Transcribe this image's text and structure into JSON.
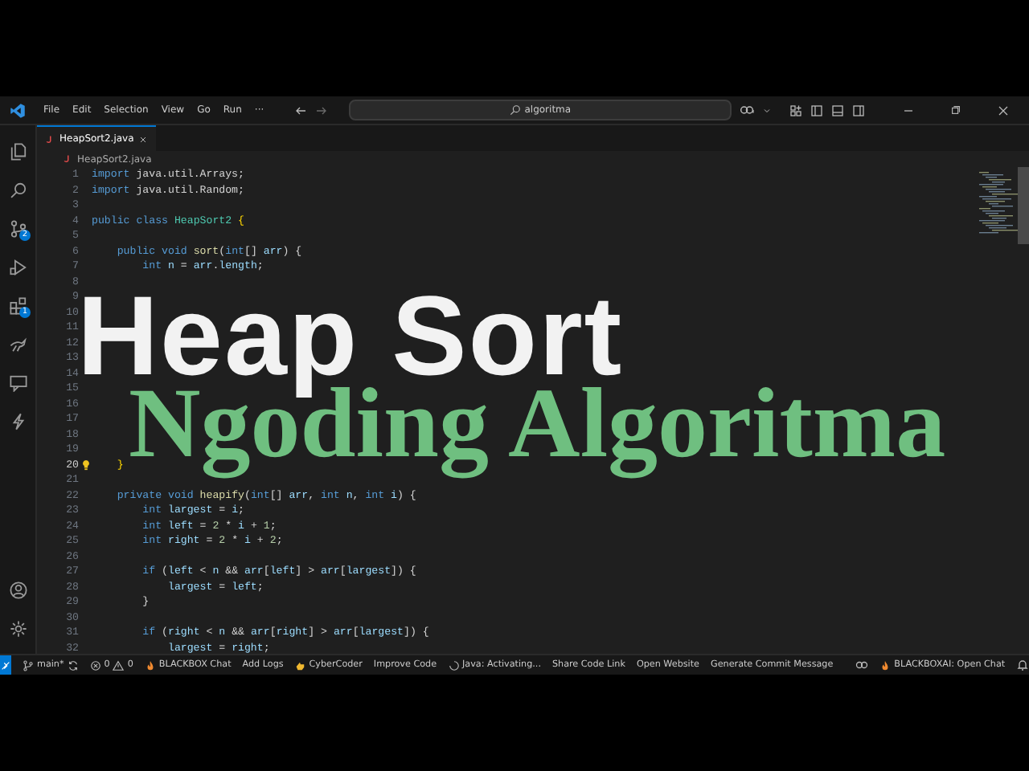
{
  "title_bar": {
    "menu": [
      "File",
      "Edit",
      "Selection",
      "View",
      "Go",
      "Run",
      "···"
    ],
    "search": {
      "value": "algoritma"
    }
  },
  "activity_bar": {
    "items": [
      {
        "kind": "files"
      },
      {
        "kind": "search"
      },
      {
        "kind": "source-control",
        "badge": "2"
      },
      {
        "kind": "run"
      },
      {
        "kind": "extensions",
        "badge": "1"
      },
      {
        "kind": "kangaroo"
      },
      {
        "kind": "chat"
      },
      {
        "kind": "bolt"
      }
    ],
    "bottom": [
      {
        "kind": "account"
      },
      {
        "kind": "settings"
      }
    ]
  },
  "tabs": [
    {
      "label": "HeapSort2.java",
      "selected": true
    }
  ],
  "breadcrumb": "HeapSort2.java",
  "code": {
    "lines": [
      {
        "n": "1",
        "active": false,
        "segments": [
          {
            "kind": "keyword",
            "text": "import"
          },
          {
            "kind": "plain",
            "text": " java.util.Arrays;"
          }
        ]
      },
      {
        "n": "2",
        "active": false,
        "segments": [
          {
            "kind": "keyword",
            "text": "import"
          },
          {
            "kind": "plain",
            "text": " java.util.Random;"
          }
        ]
      },
      {
        "n": "3",
        "active": false
      },
      {
        "n": "4",
        "active": false,
        "segments": [
          {
            "kind": "keyword",
            "text": "public class "
          },
          {
            "kind": "type",
            "text": "HeapSort2"
          },
          {
            "kind": "bracket",
            "text": " {"
          }
        ]
      },
      {
        "n": "5",
        "active": false
      },
      {
        "n": "6",
        "active": false,
        "segments": [
          {
            "kind": "keyword",
            "text": "    public void "
          },
          {
            "kind": "function",
            "text": "sort"
          },
          {
            "kind": "plain",
            "text": "("
          },
          {
            "kind": "keyword",
            "text": "int"
          },
          {
            "kind": "plain",
            "text": "[] "
          },
          {
            "kind": "variable",
            "text": "arr"
          },
          {
            "kind": "plain",
            "text": ") {"
          }
        ]
      },
      {
        "n": "7",
        "active": false,
        "segments": [
          {
            "kind": "keyword",
            "text": "        int "
          },
          {
            "kind": "variable",
            "text": "n"
          },
          {
            "kind": "plain",
            "text": " = "
          },
          {
            "kind": "variable",
            "text": "arr"
          },
          {
            "kind": "plain",
            "text": "."
          },
          {
            "kind": "variable",
            "text": "length"
          },
          {
            "kind": "plain",
            "text": ";"
          }
        ]
      },
      {
        "n": "8",
        "active": false
      },
      {
        "n": "9",
        "active": false
      },
      {
        "n": "10",
        "active": false
      },
      {
        "n": "11",
        "active": false
      },
      {
        "n": "12",
        "active": false
      },
      {
        "n": "13",
        "active": false
      },
      {
        "n": "14",
        "active": false
      },
      {
        "n": "15",
        "active": false
      },
      {
        "n": "16",
        "active": false
      },
      {
        "n": "17",
        "active": false
      },
      {
        "n": "18",
        "active": false
      },
      {
        "n": "19",
        "active": false
      },
      {
        "n": "20",
        "active": true,
        "lightbulb": true,
        "segments": [
          {
            "kind": "bracket",
            "text": "    }"
          }
        ]
      },
      {
        "n": "21",
        "active": false
      },
      {
        "n": "22",
        "active": false,
        "segments": [
          {
            "kind": "keyword",
            "text": "    private void "
          },
          {
            "kind": "function",
            "text": "heapify"
          },
          {
            "kind": "plain",
            "text": "("
          },
          {
            "kind": "keyword",
            "text": "int"
          },
          {
            "kind": "plain",
            "text": "[] "
          },
          {
            "kind": "variable",
            "text": "arr"
          },
          {
            "kind": "plain",
            "text": ", "
          },
          {
            "kind": "keyword",
            "text": "int "
          },
          {
            "kind": "variable",
            "text": "n"
          },
          {
            "kind": "plain",
            "text": ", "
          },
          {
            "kind": "keyword",
            "text": "int "
          },
          {
            "kind": "variable",
            "text": "i"
          },
          {
            "kind": "plain",
            "text": ") {"
          }
        ]
      },
      {
        "n": "23",
        "active": false,
        "segments": [
          {
            "kind": "keyword",
            "text": "        int "
          },
          {
            "kind": "variable",
            "text": "largest"
          },
          {
            "kind": "plain",
            "text": " = "
          },
          {
            "kind": "variable",
            "text": "i"
          },
          {
            "kind": "plain",
            "text": ";"
          }
        ]
      },
      {
        "n": "24",
        "active": false,
        "segments": [
          {
            "kind": "keyword",
            "text": "        int "
          },
          {
            "kind": "variable",
            "text": "left"
          },
          {
            "kind": "plain",
            "text": " = "
          },
          {
            "kind": "number",
            "text": "2"
          },
          {
            "kind": "plain",
            "text": " * "
          },
          {
            "kind": "variable",
            "text": "i"
          },
          {
            "kind": "plain",
            "text": " + "
          },
          {
            "kind": "number",
            "text": "1"
          },
          {
            "kind": "plain",
            "text": ";"
          }
        ]
      },
      {
        "n": "25",
        "active": false,
        "segments": [
          {
            "kind": "keyword",
            "text": "        int "
          },
          {
            "kind": "variable",
            "text": "right"
          },
          {
            "kind": "plain",
            "text": " = "
          },
          {
            "kind": "number",
            "text": "2"
          },
          {
            "kind": "plain",
            "text": " * "
          },
          {
            "kind": "variable",
            "text": "i"
          },
          {
            "kind": "plain",
            "text": " + "
          },
          {
            "kind": "number",
            "text": "2"
          },
          {
            "kind": "plain",
            "text": ";"
          }
        ]
      },
      {
        "n": "26",
        "active": false
      },
      {
        "n": "27",
        "active": false,
        "segments": [
          {
            "kind": "keyword",
            "text": "        if"
          },
          {
            "kind": "plain",
            "text": " ("
          },
          {
            "kind": "variable",
            "text": "left"
          },
          {
            "kind": "plain",
            "text": " < "
          },
          {
            "kind": "variable",
            "text": "n"
          },
          {
            "kind": "plain",
            "text": " && "
          },
          {
            "kind": "variable",
            "text": "arr"
          },
          {
            "kind": "plain",
            "text": "["
          },
          {
            "kind": "variable",
            "text": "left"
          },
          {
            "kind": "plain",
            "text": "] > "
          },
          {
            "kind": "variable",
            "text": "arr"
          },
          {
            "kind": "plain",
            "text": "["
          },
          {
            "kind": "variable",
            "text": "largest"
          },
          {
            "kind": "plain",
            "text": "]) {"
          }
        ]
      },
      {
        "n": "28",
        "active": false,
        "segments": [
          {
            "kind": "variable",
            "text": "            largest"
          },
          {
            "kind": "plain",
            "text": " = "
          },
          {
            "kind": "variable",
            "text": "left"
          },
          {
            "kind": "plain",
            "text": ";"
          }
        ]
      },
      {
        "n": "29",
        "active": false,
        "segments": [
          {
            "kind": "plain",
            "text": "        }"
          }
        ]
      },
      {
        "n": "30",
        "active": false
      },
      {
        "n": "31",
        "active": false,
        "segments": [
          {
            "kind": "keyword",
            "text": "        if"
          },
          {
            "kind": "plain",
            "text": " ("
          },
          {
            "kind": "variable",
            "text": "right"
          },
          {
            "kind": "plain",
            "text": " < "
          },
          {
            "kind": "variable",
            "text": "n"
          },
          {
            "kind": "plain",
            "text": " && "
          },
          {
            "kind": "variable",
            "text": "arr"
          },
          {
            "kind": "plain",
            "text": "["
          },
          {
            "kind": "variable",
            "text": "right"
          },
          {
            "kind": "plain",
            "text": "] > "
          },
          {
            "kind": "variable",
            "text": "arr"
          },
          {
            "kind": "plain",
            "text": "["
          },
          {
            "kind": "variable",
            "text": "largest"
          },
          {
            "kind": "plain",
            "text": "]) {"
          }
        ]
      },
      {
        "n": "32",
        "active": false,
        "segments": [
          {
            "kind": "variable",
            "text": "            largest"
          },
          {
            "kind": "plain",
            "text": " = "
          },
          {
            "kind": "variable",
            "text": "right"
          },
          {
            "kind": "plain",
            "text": ";"
          }
        ]
      }
    ]
  },
  "headline": {
    "title": "Heap Sort",
    "subtitle": "Ngoding Algoritma"
  },
  "status_bar": {
    "items": [
      {
        "kind": "remote"
      },
      {
        "kind": "branch",
        "label": "main*"
      },
      {
        "kind": "problems",
        "errors": "0",
        "warnings": "0"
      },
      {
        "kind": "flame",
        "label": "BLACKBOX Chat"
      },
      {
        "kind": "text",
        "label": "Add Logs"
      },
      {
        "kind": "hand",
        "label": "CyberCoder"
      },
      {
        "kind": "text",
        "label": "Improve Code"
      },
      {
        "kind": "spinner",
        "label": "Java: Activating..."
      },
      {
        "kind": "text",
        "label": "Share Code Link"
      },
      {
        "kind": "text",
        "label": "Open Website"
      },
      {
        "kind": "text",
        "label": "Generate Commit Message"
      },
      {
        "kind": "copilot"
      },
      {
        "kind": "flame",
        "label": "BLACKBOXAI: Open Chat"
      },
      {
        "kind": "bell"
      }
    ]
  }
}
